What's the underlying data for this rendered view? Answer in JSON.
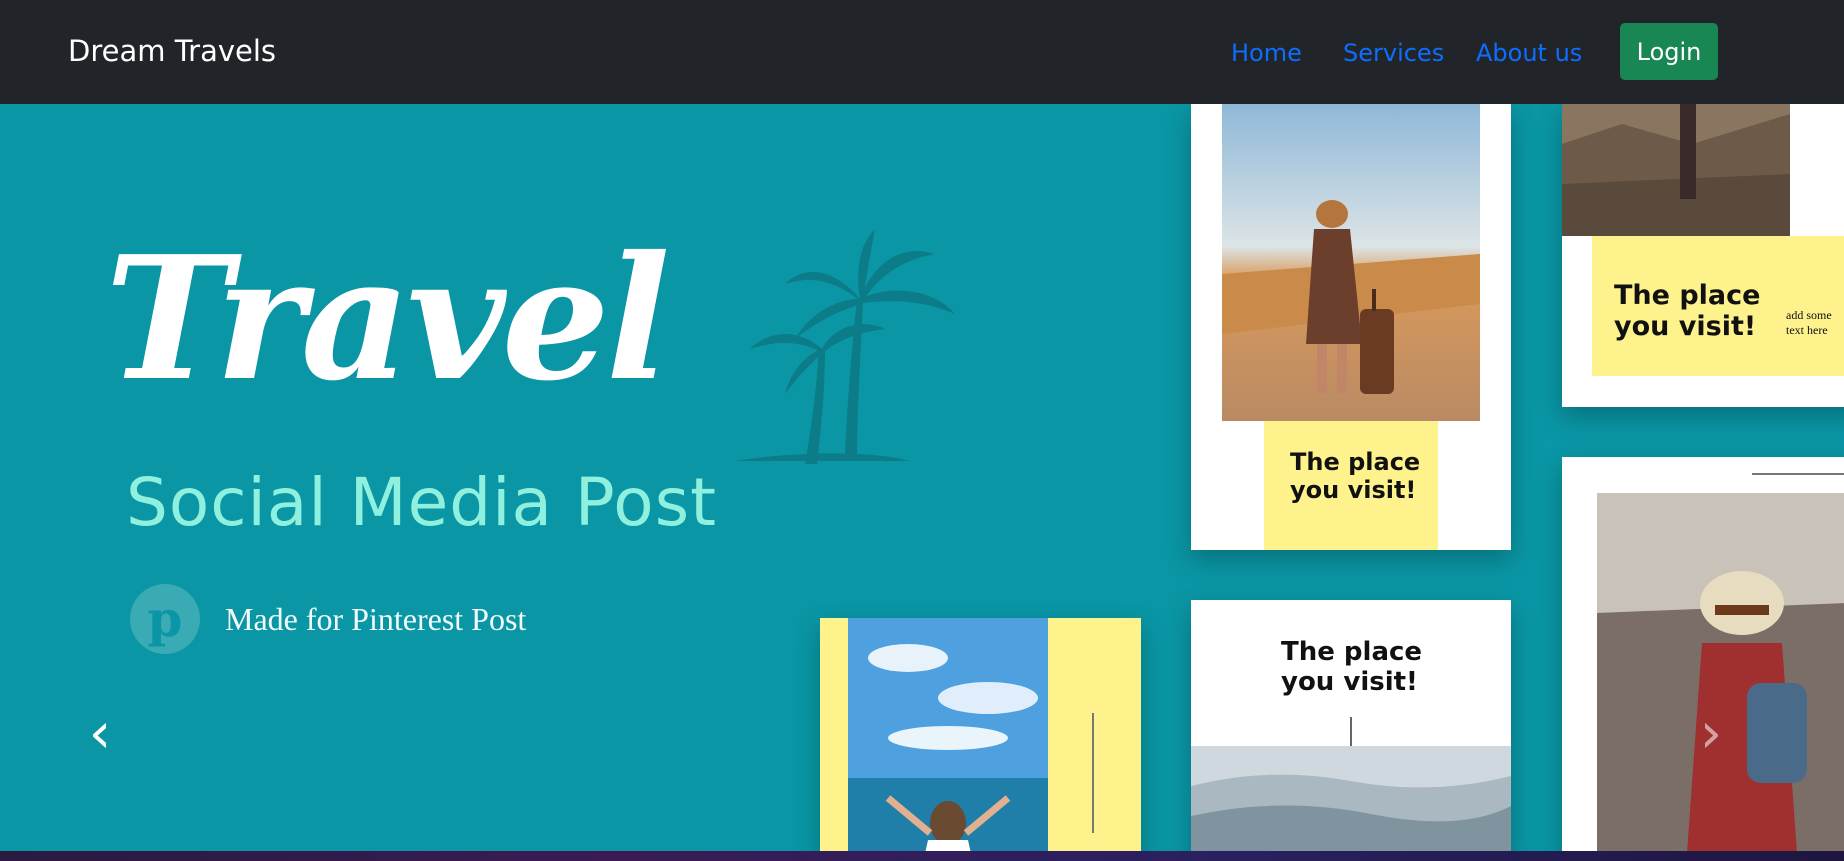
{
  "navbar": {
    "brand": "Dream Travels",
    "links": [
      "Home",
      "Services",
      "About us"
    ],
    "login_label": "Login"
  },
  "hero": {
    "title": "Travel",
    "subtitle": "Social Media Post",
    "pin_letter": "p",
    "made_for": "Made for Pinterest Post",
    "card_caption_line1": "The place",
    "card_caption_line2": "you visit!",
    "card_small_text_line1": "add some",
    "card_small_text_line2": "text here",
    "prev_arrow": "‹",
    "next_arrow": "›"
  },
  "colors": {
    "navbar_bg": "#212529",
    "link": "#0d6efd",
    "login_bg": "#198754",
    "hero_bg": "#0a96a5",
    "caption_yellow": "#fdf28c"
  }
}
